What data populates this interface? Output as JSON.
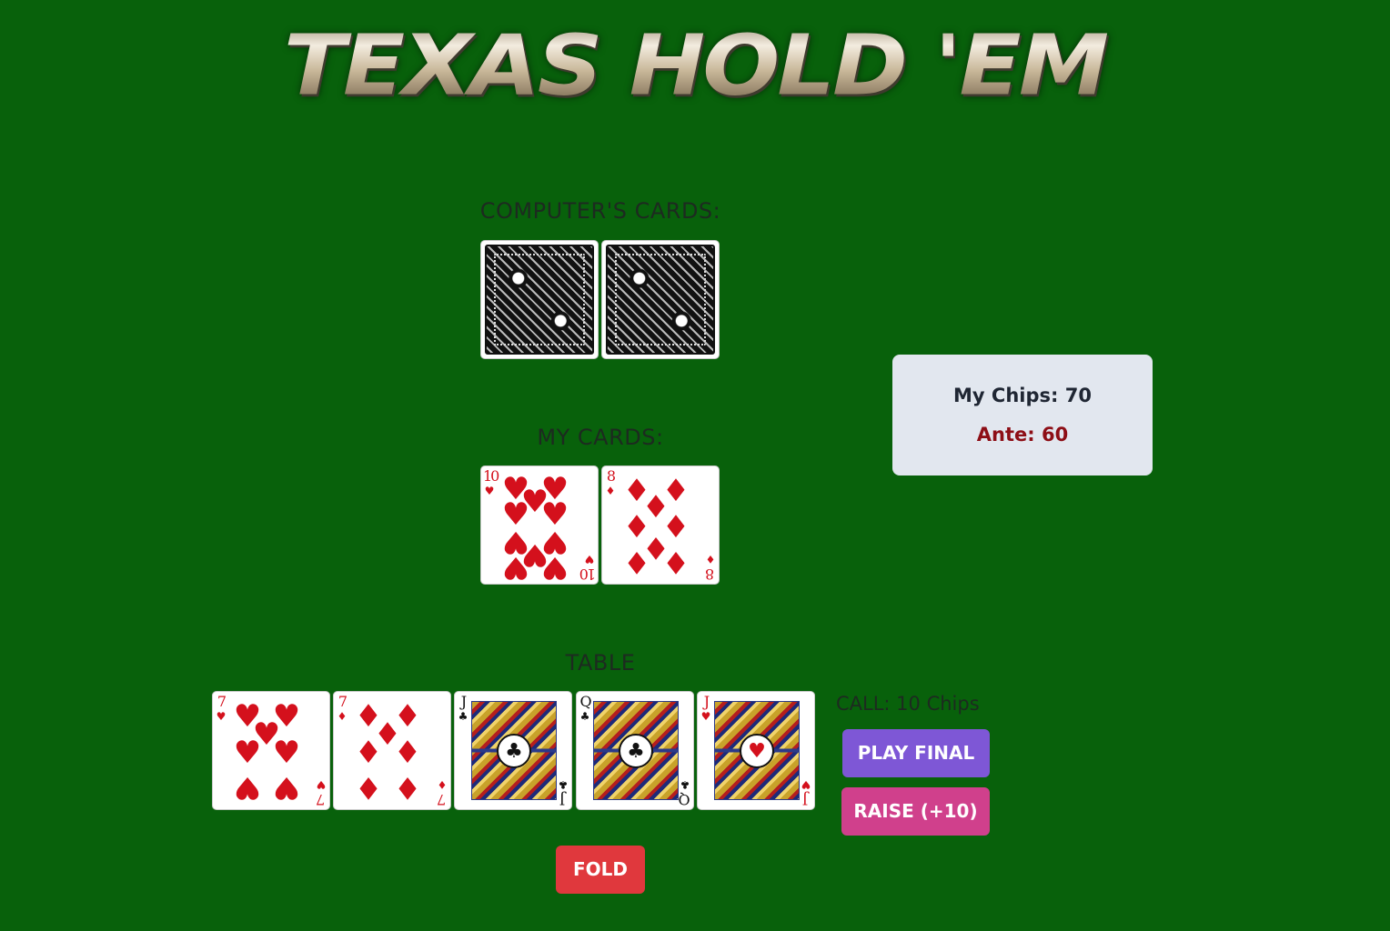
{
  "title": "TEXAS HOLD 'EM",
  "computer": {
    "label": "COMPUTER'S CARDS:",
    "cards": [
      "back",
      "back"
    ]
  },
  "player": {
    "label": "MY CARDS:",
    "cards": [
      {
        "rank": "10",
        "suit": "hearts",
        "symbol": "♥"
      },
      {
        "rank": "8",
        "suit": "diamonds",
        "symbol": "♦"
      }
    ]
  },
  "table": {
    "label": "TABLE",
    "cards": [
      {
        "rank": "7",
        "suit": "hearts",
        "symbol": "♥"
      },
      {
        "rank": "7",
        "suit": "diamonds",
        "symbol": "♦"
      },
      {
        "rank": "J",
        "suit": "clubs",
        "symbol": "♣"
      },
      {
        "rank": "Q",
        "suit": "clubs",
        "symbol": "♣"
      },
      {
        "rank": "J",
        "suit": "hearts",
        "symbol": "♥"
      }
    ]
  },
  "status": {
    "chips_text": "My Chips: 70",
    "ante_text": "Ante: 60"
  },
  "actions": {
    "call_text": "CALL: 10 Chips",
    "play_final_label": "PLAY FINAL",
    "raise_label": "RAISE (+10)",
    "fold_label": "FOLD"
  },
  "colors": {
    "felt": "#08610b",
    "play_final": "#7e57d6",
    "raise": "#d0408c",
    "fold": "#e0383d",
    "ante": "#8d0e16"
  }
}
